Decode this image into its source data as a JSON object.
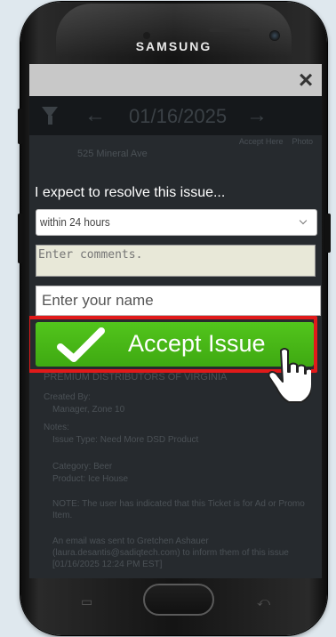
{
  "phone": {
    "brand": "SAMSUNG"
  },
  "modal": {
    "close_symbol": "×"
  },
  "background_app": {
    "date": "01/16/2025",
    "back_arrow": "←",
    "forward_arrow": "→",
    "tool_accept": "Accept Here",
    "tool_photo": "Photo",
    "address": "525 Mineral Ave",
    "org_name": "PREMIUM DISTRIBUTORS OF VIRGINIA",
    "created_by_label": "Created By:",
    "created_by_value": "Manager, Zone 10",
    "notes_label": "Notes:",
    "issue_type": "Issue Type: Need More DSD Product",
    "category": "Category: Beer",
    "product": "Product: Ice House",
    "note_ad": "NOTE: The user has indicated that this Ticket is for Ad or Promo Item.",
    "email_note": "An email was sent to Gretchen Ashauer (laura.desantis@sadiqtech.com) to inform them of this issue [01/16/2025 12:24 PM EST]"
  },
  "form": {
    "prompt": "I expect to resolve this issue...",
    "resolve_select_value": "within 24 hours",
    "comments_placeholder": "Enter comments.",
    "name_placeholder": "Enter your name",
    "accept_label": "Accept Issue"
  },
  "colors": {
    "accent_green": "#44b015",
    "highlight_red": "#e11a1a",
    "overlay_dark": "#262a2e"
  },
  "icons": [
    "close-icon",
    "filter-icon",
    "chevron-down-icon",
    "checkmark-icon",
    "pointer-hand-icon"
  ]
}
